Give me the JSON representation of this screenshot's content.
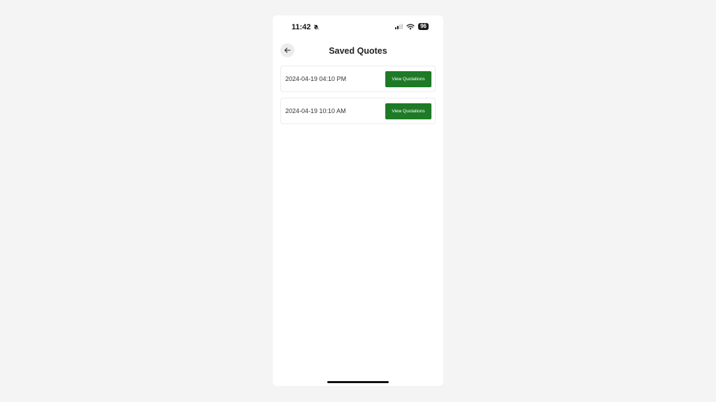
{
  "status_bar": {
    "time": "11:42",
    "battery": "96",
    "icons": [
      "bell-slash-icon",
      "signal-icon",
      "wifi-icon"
    ]
  },
  "header": {
    "title": "Saved Quotes",
    "back_icon": "arrow-left-icon"
  },
  "quotes": [
    {
      "date": "2024-04-19 04:10 PM",
      "button_label": "View Quotations"
    },
    {
      "date": "2024-04-19 10:10 AM",
      "button_label": "View Quotations"
    }
  ],
  "colors": {
    "accent": "#1e7a26",
    "background": "#f4f4f4",
    "card_border": "#ececec"
  }
}
